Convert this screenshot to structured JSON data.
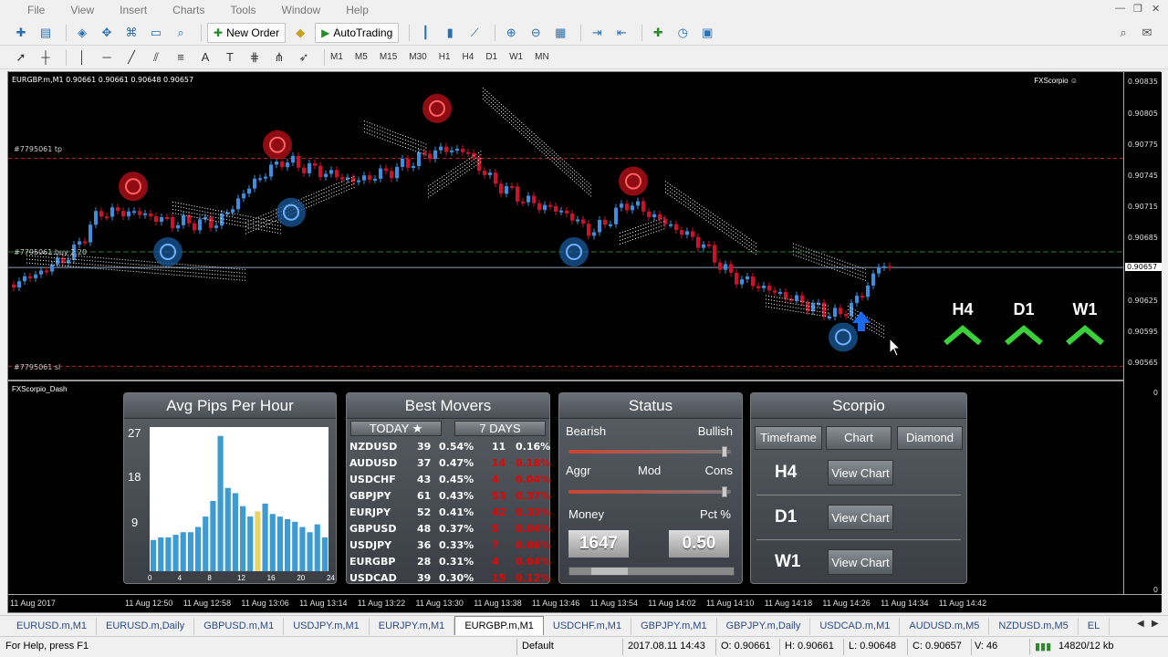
{
  "menu": [
    "File",
    "View",
    "Insert",
    "Charts",
    "Tools",
    "Window",
    "Help"
  ],
  "toolbar": {
    "new_order": "New Order",
    "autotrading": "AutoTrading"
  },
  "timeframes": [
    "M1",
    "M5",
    "M15",
    "M30",
    "H1",
    "H4",
    "D1",
    "W1",
    "MN"
  ],
  "chart": {
    "info": "EURGBP.m,M1  0.90661 0.90661 0.90648 0.90657",
    "brand": "FXScorpio ☺",
    "tp_label": "#7795061 tp",
    "buy_label": "#7795061 buy 2.20",
    "sl_label": "#7795061 sl",
    "price_labels": [
      "0.90835",
      "0.90805",
      "0.90775",
      "0.90745",
      "0.90715",
      "0.90685",
      "0.90657",
      "0.90625",
      "0.90595",
      "0.90565"
    ],
    "current_price": "0.90657",
    "subwindow_label": "FXScorpio_Dash",
    "sub_scale_top": "0",
    "sub_scale_bottom": "0",
    "time_labels": [
      "11 Aug 2017",
      "11 Aug 12:50",
      "11 Aug 12:58",
      "11 Aug 13:06",
      "11 Aug 13:14",
      "11 Aug 13:22",
      "11 Aug 13:30",
      "11 Aug 13:38",
      "11 Aug 13:46",
      "11 Aug 13:54",
      "11 Aug 14:02",
      "11 Aug 14:10",
      "11 Aug 14:18",
      "11 Aug 14:26",
      "11 Aug 14:34",
      "11 Aug 14:42"
    ],
    "trend_blocks": [
      {
        "label": "H4",
        "direction": "up"
      },
      {
        "label": "D1",
        "direction": "up"
      },
      {
        "label": "W1",
        "direction": "up"
      }
    ]
  },
  "avg_pips": {
    "title": "Avg Pips Per Hour",
    "y_ticks": [
      "27",
      "18",
      "9"
    ],
    "x_ticks": [
      "0",
      "4",
      "8",
      "12",
      "16",
      "20",
      "24"
    ]
  },
  "chart_data": {
    "type": "bar",
    "title": "Avg Pips Per Hour",
    "categories": [
      "0",
      "1",
      "2",
      "3",
      "4",
      "5",
      "6",
      "7",
      "8",
      "9",
      "10",
      "11",
      "12",
      "13",
      "14",
      "15",
      "16",
      "17",
      "18",
      "19",
      "20",
      "21",
      "22",
      "23"
    ],
    "values": [
      6,
      6.5,
      6.5,
      7,
      7.5,
      7.5,
      8.5,
      10.5,
      13.5,
      26,
      16,
      15,
      12.5,
      10.5,
      11.5,
      13,
      11,
      10.5,
      10,
      9.5,
      8.5,
      7.5,
      9,
      6.5
    ],
    "highlight_index": 14,
    "ylim": [
      0,
      27
    ],
    "colors": {
      "bar": "#3d9bd1",
      "highlight": "#e6d566"
    }
  },
  "movers": {
    "title": "Best Movers",
    "tab_today": "TODAY ★",
    "tab_7days": "7 DAYS",
    "rows": [
      {
        "pair": "NZDUSD",
        "pips": "39",
        "pct": "0.54%",
        "pips7": "11",
        "pct7": "0.16%",
        "red": false
      },
      {
        "pair": "AUDUSD",
        "pips": "37",
        "pct": "0.47%",
        "pips7": "14",
        "pct7": "0.18%",
        "red": true
      },
      {
        "pair": "USDCHF",
        "pips": "43",
        "pct": "0.45%",
        "pips7": "4",
        "pct7": "0.04%",
        "red": true
      },
      {
        "pair": "GBPJPY",
        "pips": "61",
        "pct": "0.43%",
        "pips7": "53",
        "pct7": "0.37%",
        "red": true
      },
      {
        "pair": "EURJPY",
        "pips": "52",
        "pct": "0.41%",
        "pips7": "42",
        "pct7": "0.33%",
        "red": true
      },
      {
        "pair": "GBPUSD",
        "pips": "48",
        "pct": "0.37%",
        "pips7": "5",
        "pct7": "0.04%",
        "red": true
      },
      {
        "pair": "USDJPY",
        "pips": "36",
        "pct": "0.33%",
        "pips7": "7",
        "pct7": "0.06%",
        "red": true
      },
      {
        "pair": "EURGBP",
        "pips": "28",
        "pct": "0.31%",
        "pips7": "4",
        "pct7": "0.04%",
        "red": true
      },
      {
        "pair": "USDCAD",
        "pips": "39",
        "pct": "0.30%",
        "pips7": "15",
        "pct7": "0.12%",
        "red": true
      }
    ]
  },
  "status": {
    "title": "Status",
    "bearish": "Bearish",
    "bullish": "Bullish",
    "aggr": "Aggr",
    "mod": "Mod",
    "cons": "Cons",
    "money": "Money",
    "pct": "Pct %",
    "money_value": "1647",
    "pct_value": "0.50"
  },
  "scorpio": {
    "title": "Scorpio",
    "col_timeframe": "Timeframe",
    "col_chart": "Chart",
    "col_diamond": "Diamond",
    "rows": [
      {
        "tf": "H4",
        "btn": "View Chart"
      },
      {
        "tf": "D1",
        "btn": "View Chart"
      },
      {
        "tf": "W1",
        "btn": "View Chart"
      }
    ]
  },
  "tabs": [
    "EURUSD.m,M1",
    "EURUSD.m,Daily",
    "GBPUSD.m,M1",
    "USDJPY.m,M1",
    "EURJPY.m,M1",
    "EURGBP.m,M1",
    "USDCHF.m,M1",
    "GBPJPY.m,M1",
    "GBPJPY.m,Daily",
    "USDCAD.m,M1",
    "AUDUSD.m,M5",
    "NZDUSD.m,M5",
    "EL"
  ],
  "active_tab": 5,
  "statusbar": {
    "help": "For Help, press F1",
    "profile": "Default",
    "datetime": "2017.08.11 14:43",
    "open": "O: 0.90661",
    "high": "H: 0.90661",
    "low": "L: 0.90648",
    "close": "C: 0.90657",
    "volume": "V: 46",
    "traffic": "14820/12 kb"
  },
  "colors": {
    "bull": "#3a8fe0",
    "bear": "#d0102a",
    "arrow": "#3ad13a",
    "tp_line": "#b02020",
    "buy_line": "#2a7a3a"
  }
}
